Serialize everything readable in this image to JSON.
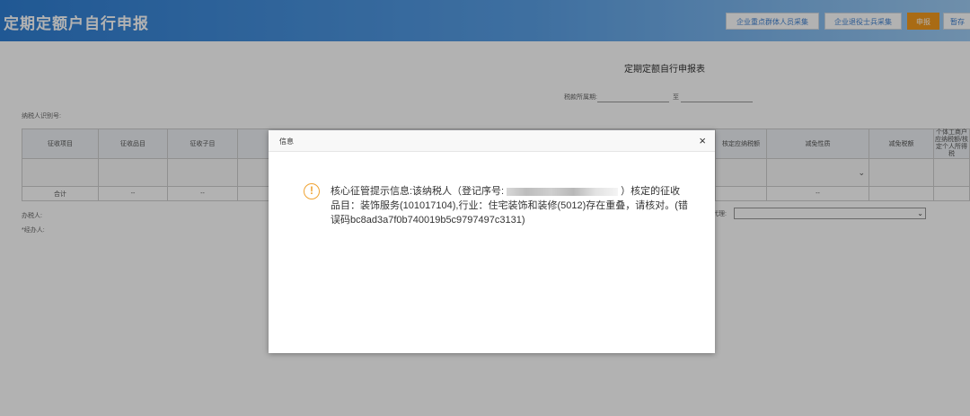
{
  "header": {
    "title": "定期定额户自行申报",
    "buttons": [
      "企业重点群体人员采集",
      "企业退役士兵采集",
      "申报",
      "暂存"
    ]
  },
  "form": {
    "title": "定期定额自行申报表",
    "period_label": "税款所属期:",
    "period_to": "至",
    "taxpayer_id_label": "纳税人识别号:",
    "columns": [
      "征收项目",
      "征收品目",
      "征收子目",
      "",
      "核定应纳税额",
      "减免性质",
      "减免税额",
      "个体工商户应纳税额/核定个人所得税"
    ],
    "total_label": "合计",
    "dash": "--",
    "taxpayer_sig": "办税人:",
    "agent_sig": "*经办人:",
    "select_label": "代理:"
  },
  "dialog": {
    "title": "信息",
    "close": "×",
    "warn_glyph": "!",
    "message_part1": "核心征管提示信息:该纳税人（登记序号:",
    "message_part2": "）核定的征收品目：装饰服务(101017104),行业：住宅装饰和装修(5012)存在重叠，请核对。(错误码bc8ad3a7f0b740019b5c9797497c3131)"
  },
  "colors": {
    "header_start": "#2f7fd4",
    "accent_orange": "#f39a1e",
    "warn": "#f0a332"
  }
}
